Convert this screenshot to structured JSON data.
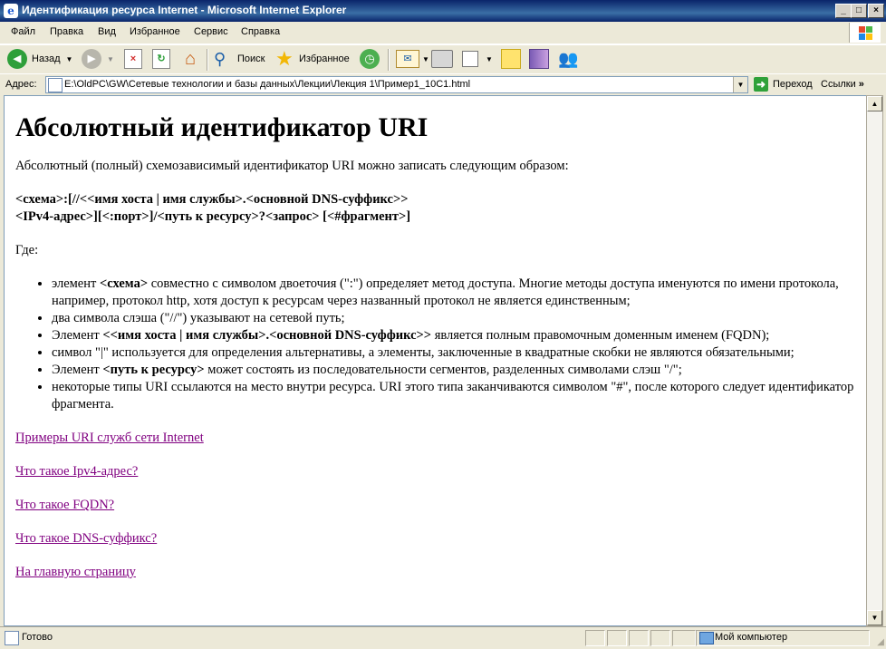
{
  "window": {
    "title": "Идентификация ресурса Internet - Microsoft Internet Explorer",
    "minimize": "_",
    "maximize": "□",
    "close": "×"
  },
  "menu": {
    "items": [
      "Файл",
      "Правка",
      "Вид",
      "Избранное",
      "Сервис",
      "Справка"
    ]
  },
  "toolbar": {
    "back_label": "Назад",
    "search_label": "Поиск",
    "favorites_label": "Избранное"
  },
  "address": {
    "label": "Адрес:",
    "url": "E:\\OldPC\\GW\\Сетевые технологии и базы данных\\Лекции\\Лекция 1\\Пример1_10С1.html",
    "go_label": "Переход",
    "links_label": "Ссылки"
  },
  "page": {
    "heading": "Абсолютный идентификатор URI",
    "intro": "Абсолютный (полный) схемозависимый идентификатор URI можно записать следующим образом:",
    "syntax_line1": "<схема>:[//<<имя хоста | имя службы>.<основной DNS-суффикс>>",
    "syntax_line2": "<IPv4-адрес>][<:порт>]/<путь к ресурсу>?<запрос> [<#фрагмент>]",
    "where": "Где:",
    "bullets": [
      {
        "pre": "элемент ",
        "bold": "<схема>",
        "post": " совместно с символом двоеточия (\":\") определяет метод доступа. Многие методы доступа именуются по имени протокола, например, протокол http, хотя доступ к ресурсам через названный протокол не является единственным;"
      },
      {
        "pre": "два символа слэша (\"//\") указывают на сетевой путь;",
        "bold": "",
        "post": ""
      },
      {
        "pre": "Элемент ",
        "bold": "<<имя хоста | имя службы>.<основной DNS-суффикс>>",
        "post": " является полным правомочным доменным именем (FQDN);"
      },
      {
        "pre": "символ \"|\" используется для определения альтернативы, а элементы, заключенные в квадратные скобки не являются обязательными;",
        "bold": "",
        "post": ""
      },
      {
        "pre": "Элемент ",
        "bold": "<путь к ресурсу>",
        "post": " может состоять из последовательности сегментов, разделенных символами слэш \"/\";"
      },
      {
        "pre": "некоторые типы URI ссылаются на место внутри ресурса. URI этого типа заканчиваются символом \"#\", после которого следует идентификатор фрагмента.",
        "bold": "",
        "post": ""
      }
    ],
    "links": [
      "Примеры URI служб сети Internet",
      "Что такое Ipv4-адрес?",
      "Что такое FQDN?",
      "Что такое DNS-суффикс?",
      "На главную страницу"
    ]
  },
  "status": {
    "text": "Готово",
    "zone": "Мой компьютер"
  },
  "colors": {
    "titlebar": "#0A246A",
    "link_visited": "#800080",
    "chrome": "#ECE9D8"
  }
}
